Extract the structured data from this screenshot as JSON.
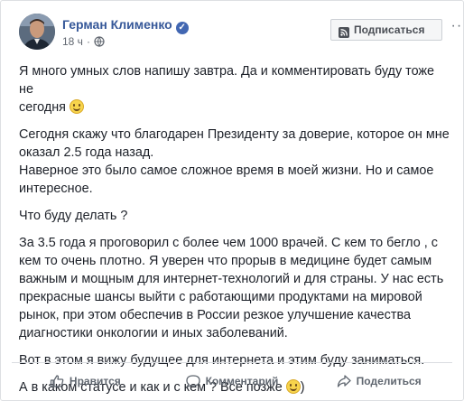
{
  "post": {
    "author": "Герман Клименко",
    "time": "18 ч",
    "subscribe_label": "Подписаться",
    "paragraphs": [
      {
        "lines": [
          "Я много умных слов напишу завтра. Да и комментировать буду тоже не",
          "сегодня"
        ],
        "emoji": "smile"
      },
      {
        "lines": [
          "Сегодня скажу что благодарен Президенту за доверие, которое он мне",
          "оказал 2.5 года назад.",
          "Наверное это было самое сложное время в моей жизни. Но и самое",
          "интересное."
        ]
      },
      {
        "lines": [
          "Что буду делать ?"
        ]
      },
      {
        "lines": [
          "За 3.5 года я проговорил с более чем 1000 врачей. С кем то бегло , с",
          "кем то очень плотно. Я уверен что прорыв в медицине будет самым",
          "важным и мощным для интернет-технологий и для страны. У нас есть",
          "прекрасные шансы выйти с работающими продуктами на мировой",
          "рынок, при этом обеспечив в России резкое улучшение качества",
          "диагностики онкологии и иных заболеваний."
        ]
      },
      {
        "lines": [
          "Вот в этом я вижу будущее для интернета и этим буду заниматься."
        ]
      },
      {
        "lines": [
          "А в каком статусе и как и с кем ? Все позже"
        ],
        "emoji": "smile",
        "suffix": ")"
      }
    ]
  },
  "actions": {
    "like": "Нравится",
    "comment": "Комментарий",
    "share": "Поделиться"
  },
  "colors": {
    "link": "#365899",
    "text": "#1d2129",
    "meta": "#616770",
    "action": "#606770",
    "border": "#dddfe2"
  },
  "icons": [
    "verified-badge-icon",
    "globe-icon",
    "rss-icon",
    "more-icon",
    "like-icon",
    "comment-icon",
    "share-icon",
    "smile-emoji"
  ]
}
